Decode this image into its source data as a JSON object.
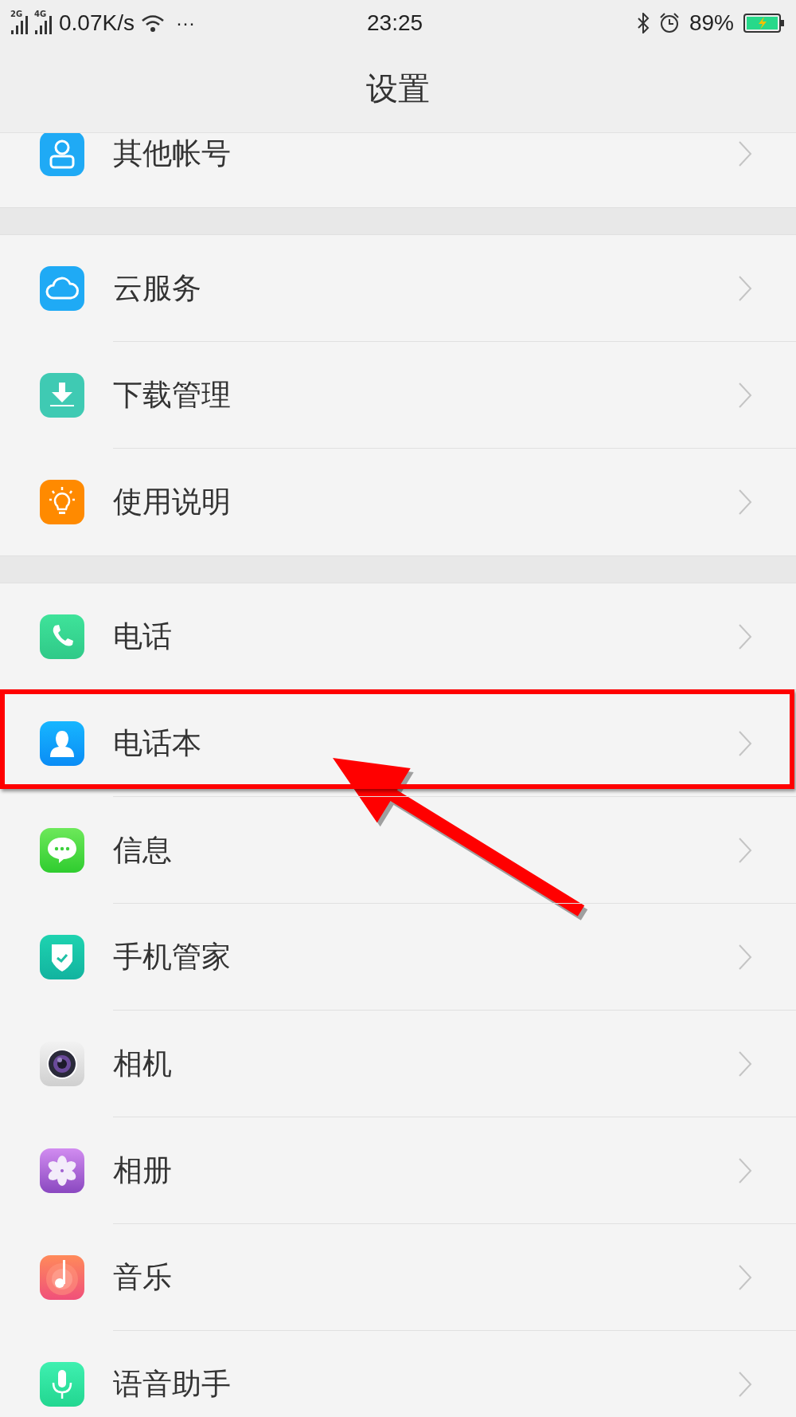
{
  "status_bar": {
    "sim1": "2G",
    "sim2": "4G",
    "speed": "0.07K/s",
    "more": "···",
    "time": "23:25",
    "battery": "89%"
  },
  "header": {
    "title": "设置"
  },
  "groups": [
    {
      "items": [
        {
          "label": "其他帐号",
          "highlighted": false
        }
      ]
    },
    {
      "items": [
        {
          "label": "云服务",
          "highlighted": false
        },
        {
          "label": "下载管理",
          "highlighted": false
        },
        {
          "label": "使用说明",
          "highlighted": false
        }
      ]
    },
    {
      "items": [
        {
          "label": "电话",
          "highlighted": false
        },
        {
          "label": "电话本",
          "highlighted": true
        },
        {
          "label": "信息",
          "highlighted": false
        },
        {
          "label": "手机管家",
          "highlighted": false
        },
        {
          "label": "相机",
          "highlighted": false
        },
        {
          "label": "相册",
          "highlighted": false
        },
        {
          "label": "音乐",
          "highlighted": false
        },
        {
          "label": "语音助手",
          "highlighted": false
        }
      ]
    }
  ]
}
